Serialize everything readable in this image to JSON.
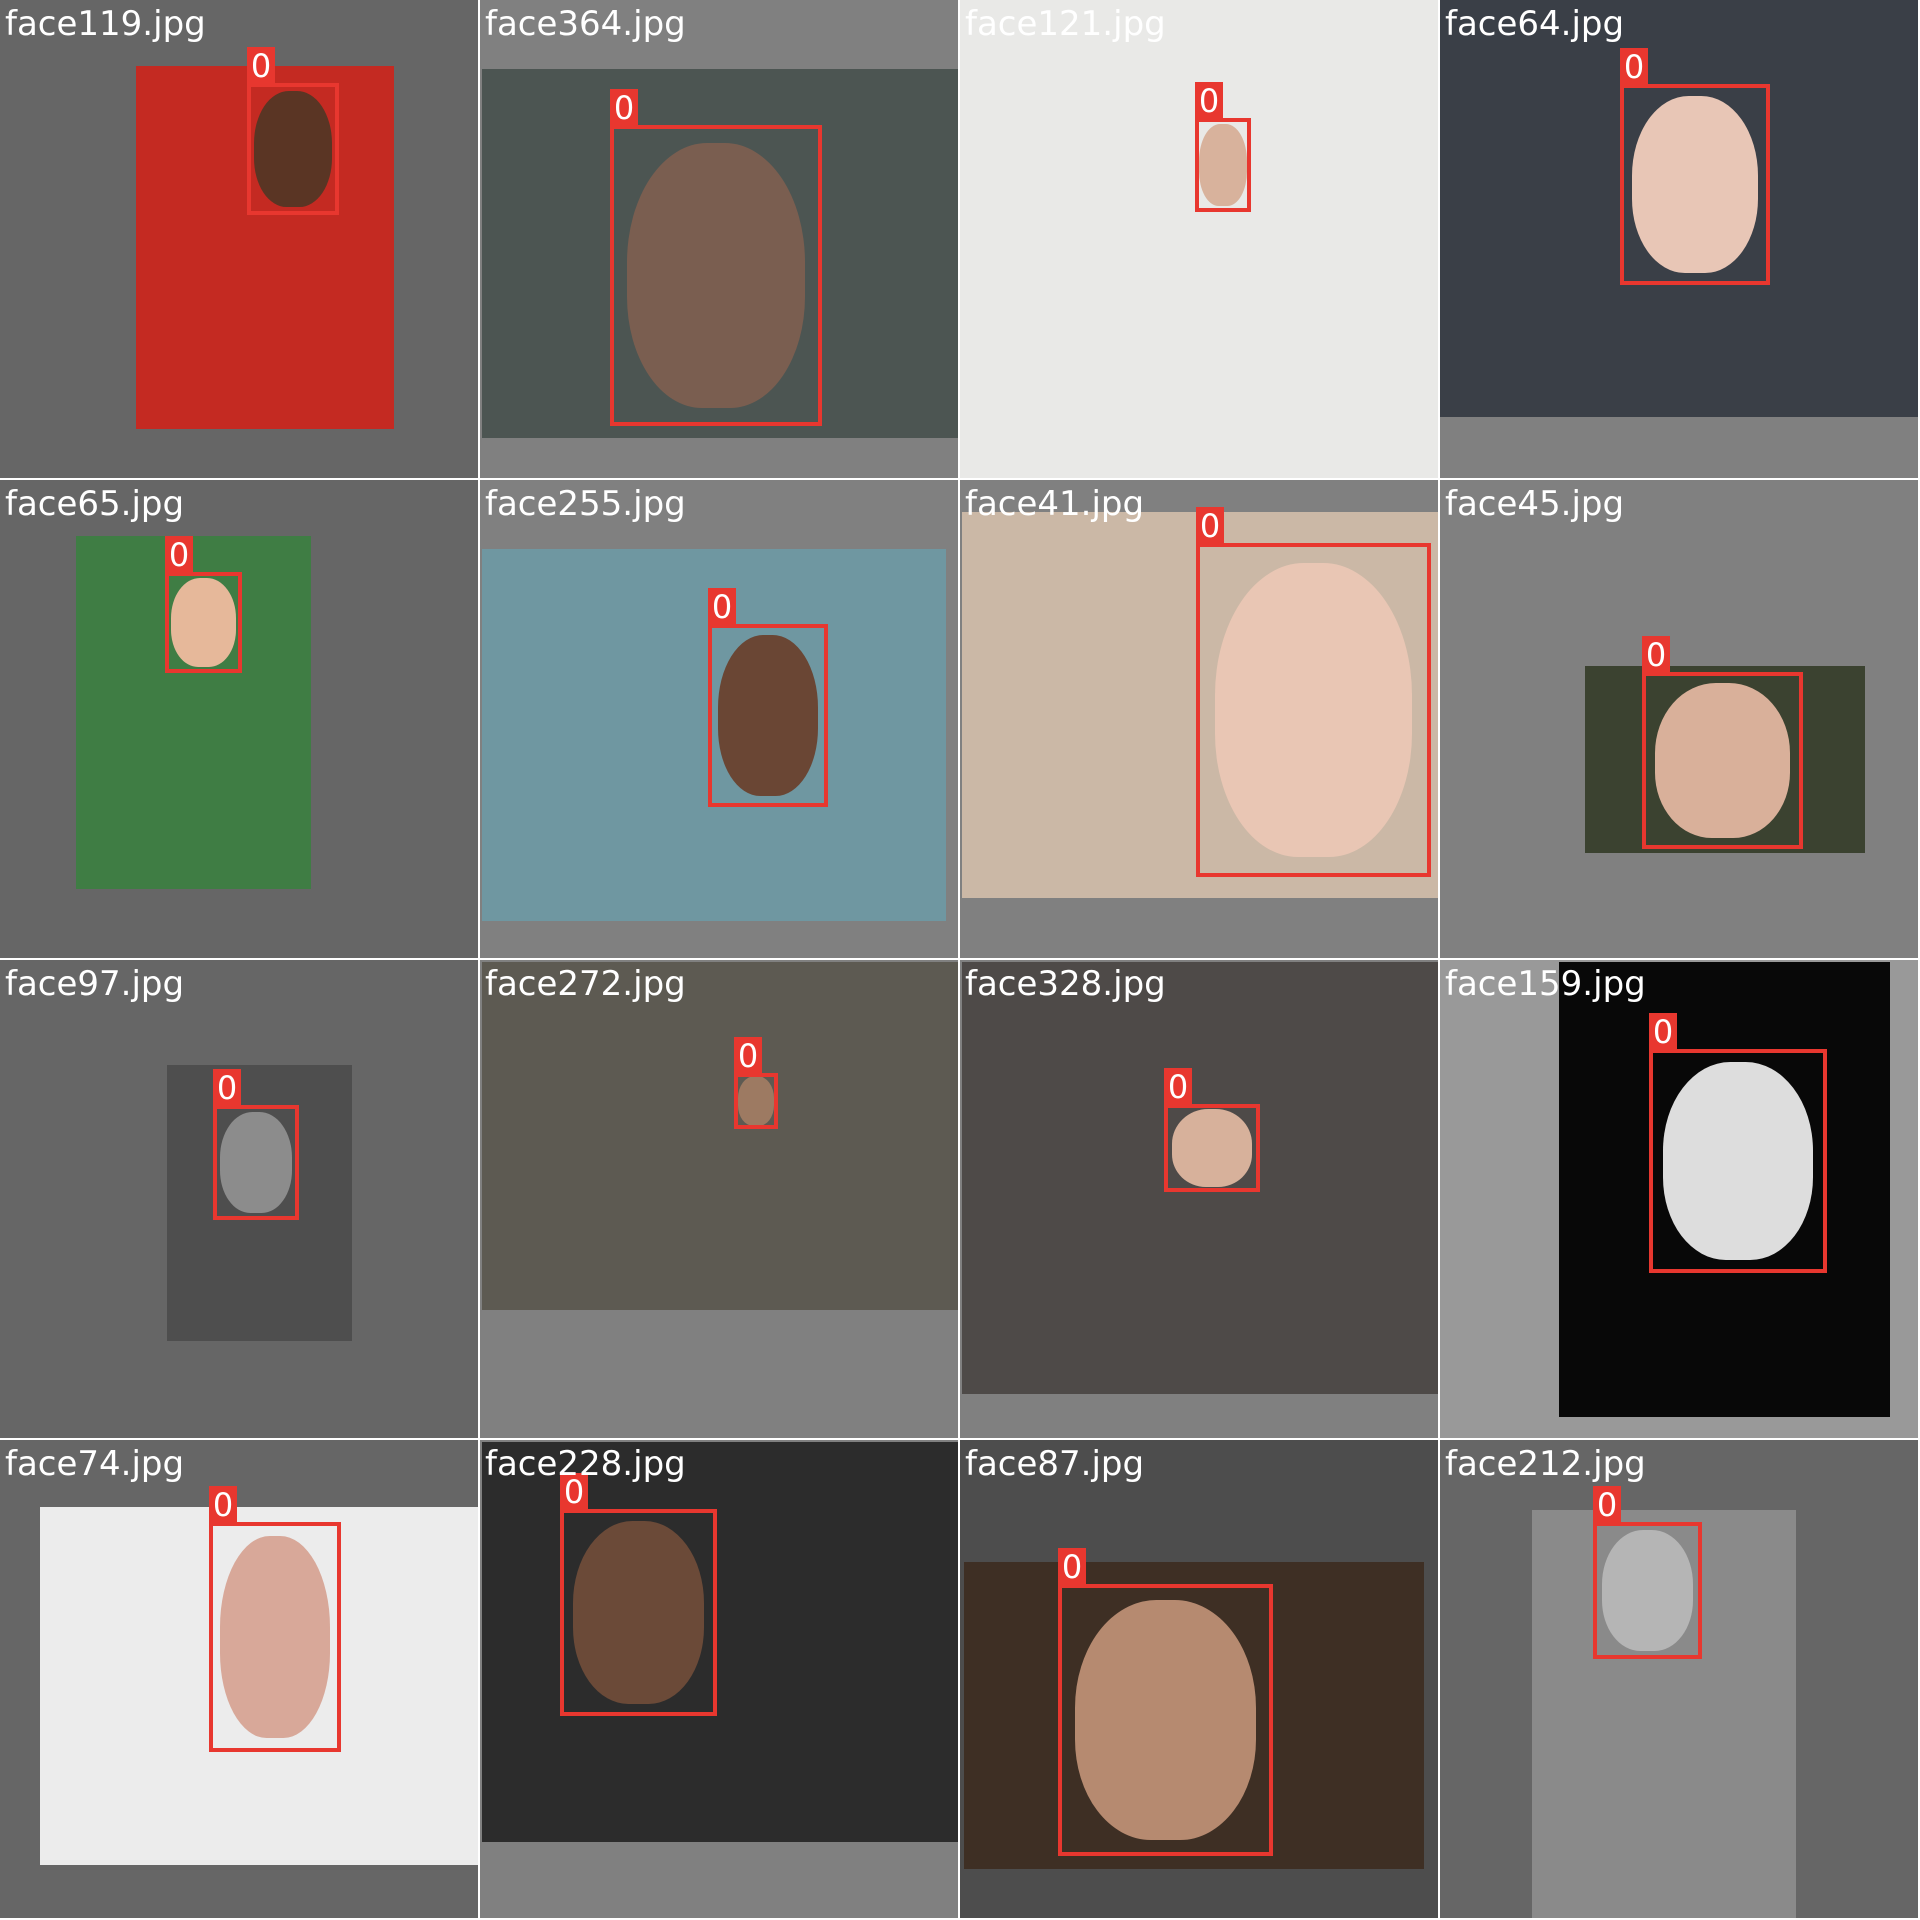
{
  "colors": {
    "box": "#e8372f",
    "label_text": "#ffffff",
    "grid_gap": "#ffffff"
  },
  "tiles": [
    {
      "filename": "face119.jpg",
      "box_label": "0",
      "tile_bg": "#666666",
      "photo_bg": "#c42a22",
      "face_color": "#5a3524"
    },
    {
      "filename": "face364.jpg",
      "box_label": "0",
      "tile_bg": "#808080",
      "photo_bg": "#4c5552",
      "face_color": "#7a5e50"
    },
    {
      "filename": "face121.jpg",
      "box_label": "0",
      "tile_bg": "#808080",
      "photo_bg": "#e9e9e7",
      "face_color": "#d8b29c"
    },
    {
      "filename": "face64.jpg",
      "box_label": "0",
      "tile_bg": "#808080",
      "photo_bg": "#3a3f47",
      "face_color": "#e8c6b6"
    },
    {
      "filename": "face65.jpg",
      "box_label": "0",
      "tile_bg": "#666666",
      "photo_bg": "#3f7d44",
      "face_color": "#e6b89a"
    },
    {
      "filename": "face255.jpg",
      "box_label": "0",
      "tile_bg": "#808080",
      "photo_bg": "#6f97a1",
      "face_color": "#6a4634"
    },
    {
      "filename": "face41.jpg",
      "box_label": "0",
      "tile_bg": "#808080",
      "photo_bg": "#cbb8a6",
      "face_color": "#e9c6b4"
    },
    {
      "filename": "face45.jpg",
      "box_label": "0",
      "tile_bg": "#808080",
      "photo_bg": "#3b4230",
      "face_color": "#d9b09a"
    },
    {
      "filename": "face97.jpg",
      "box_label": "0",
      "tile_bg": "#666666",
      "photo_bg": "#4e4e4e",
      "face_color": "#8c8c8c"
    },
    {
      "filename": "face272.jpg",
      "box_label": "0",
      "tile_bg": "#808080",
      "photo_bg": "#5d5a52",
      "face_color": "#9d7a62"
    },
    {
      "filename": "face328.jpg",
      "box_label": "0",
      "tile_bg": "#808080",
      "photo_bg": "#4e4a48",
      "face_color": "#d7b19b"
    },
    {
      "filename": "face159.jpg",
      "box_label": "0",
      "tile_bg": "#999999",
      "photo_bg": "#080808",
      "face_color": "#dddddd"
    },
    {
      "filename": "face74.jpg",
      "box_label": "0",
      "tile_bg": "#666666",
      "photo_bg": "#ececec",
      "face_color": "#d8a899"
    },
    {
      "filename": "face228.jpg",
      "box_label": "0",
      "tile_bg": "#808080",
      "photo_bg": "#2c2c2c",
      "face_color": "#6b4a38"
    },
    {
      "filename": "face87.jpg",
      "box_label": "0",
      "tile_bg": "#4d4d4d",
      "photo_bg": "#3e2f24",
      "face_color": "#b68a70"
    },
    {
      "filename": "face212.jpg",
      "box_label": "0",
      "tile_bg": "#666666",
      "photo_bg": "#8a8a8a",
      "face_color": "#b5b5b5"
    }
  ]
}
